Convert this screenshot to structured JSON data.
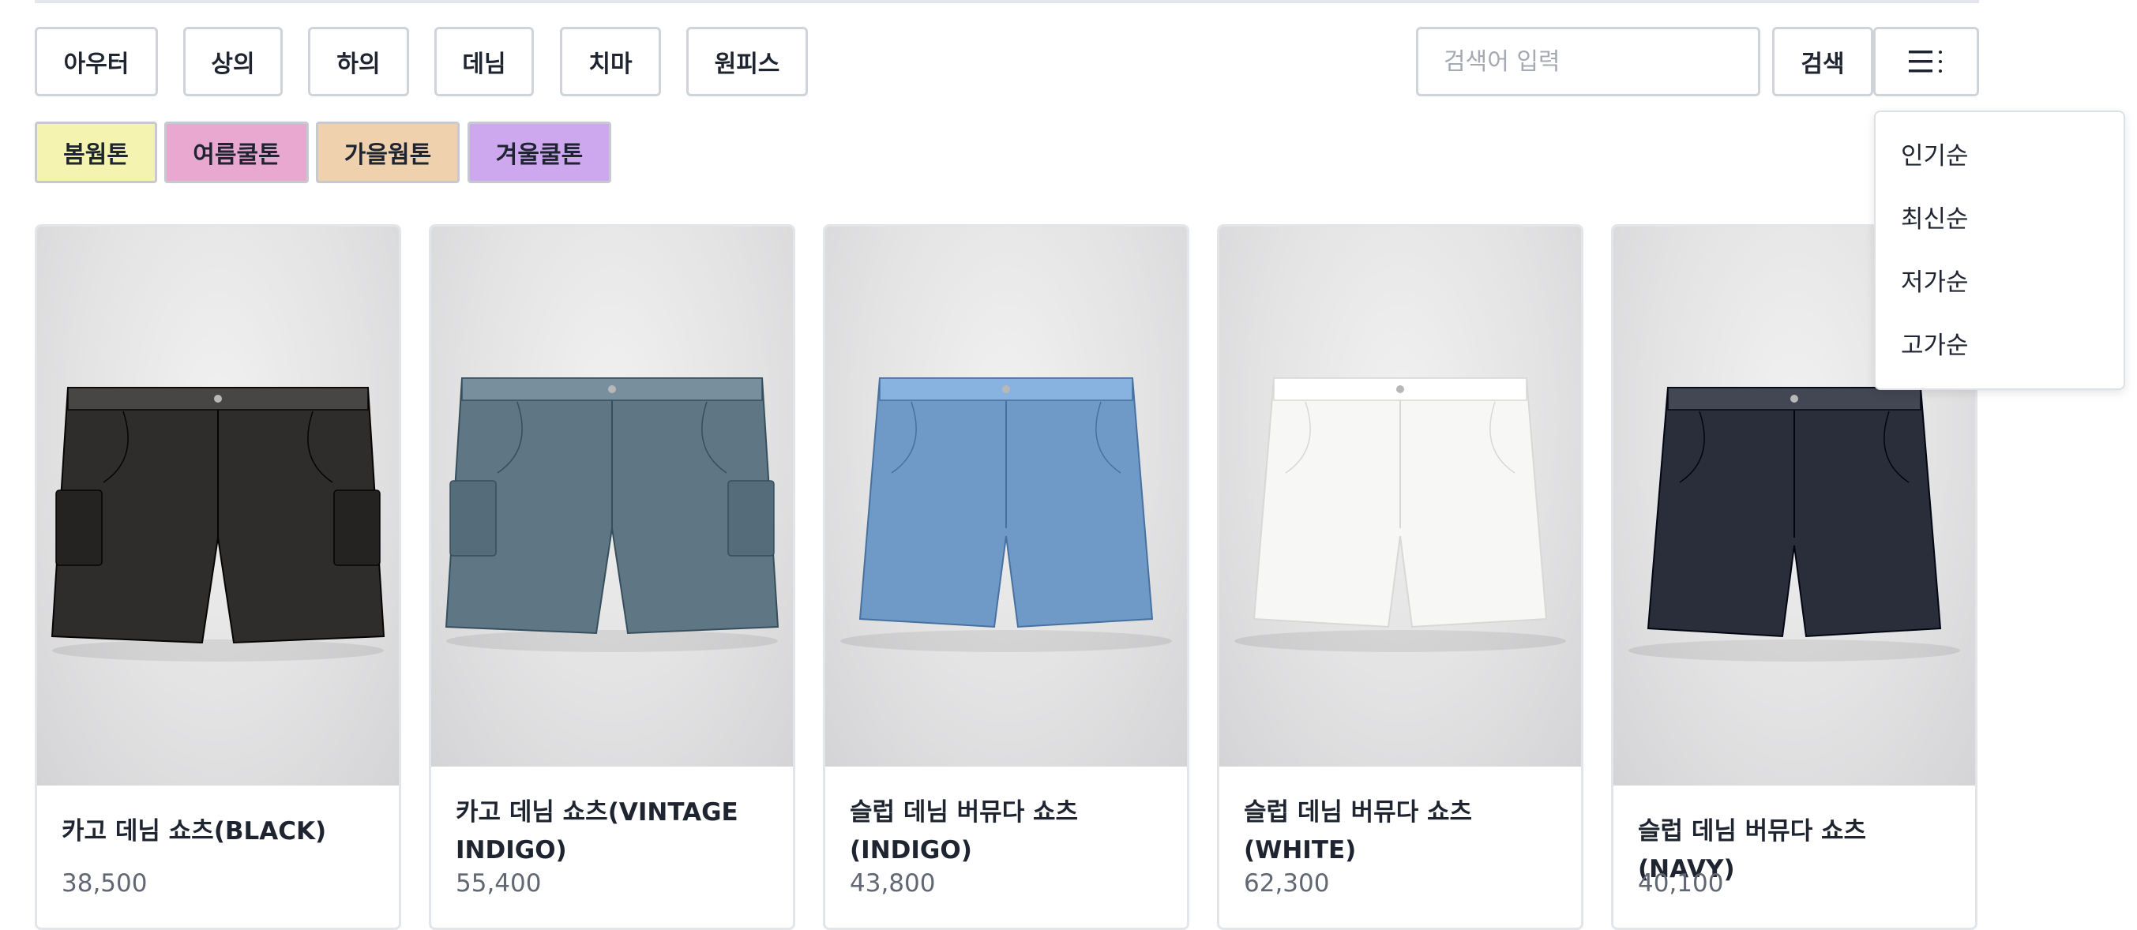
{
  "categories": [
    "아우터",
    "상의",
    "하의",
    "데님",
    "치마",
    "원피스"
  ],
  "search": {
    "placeholder": "검색어 입력",
    "button_label": "검색"
  },
  "sort_icon": "menu-sort-icon",
  "tones": [
    {
      "label": "봄웜톤",
      "color": "#f4f4b0"
    },
    {
      "label": "여름쿨톤",
      "color": "#e8a8cf"
    },
    {
      "label": "가을웜톤",
      "color": "#f0d1ae"
    },
    {
      "label": "겨울쿨톤",
      "color": "#cda8ee"
    }
  ],
  "sort_options": [
    "인기순",
    "최신순",
    "저가순",
    "고가순"
  ],
  "products": [
    {
      "name": "카고 데님 쇼츠(BLACK)",
      "price": "38,500",
      "color": "#2e2d2c",
      "style": "cargo"
    },
    {
      "name": "카고 데님 쇼츠(VINTAGE INDIGO)",
      "price": "55,400",
      "color": "#5f7785",
      "style": "cargo"
    },
    {
      "name": "슬럽 데님 버뮤다 쇼츠(INDIGO)",
      "price": "43,800",
      "color": "#6f99c6",
      "style": "bermuda"
    },
    {
      "name": "슬럽 데님 버뮤다 쇼츠(WHITE)",
      "price": "62,300",
      "color": "#f7f7f5",
      "style": "bermuda"
    },
    {
      "name": "슬럽 데님 버뮤다 쇼츠(NAVY)",
      "price": "40,100",
      "color": "#2a2e3a",
      "style": "bermuda"
    }
  ]
}
